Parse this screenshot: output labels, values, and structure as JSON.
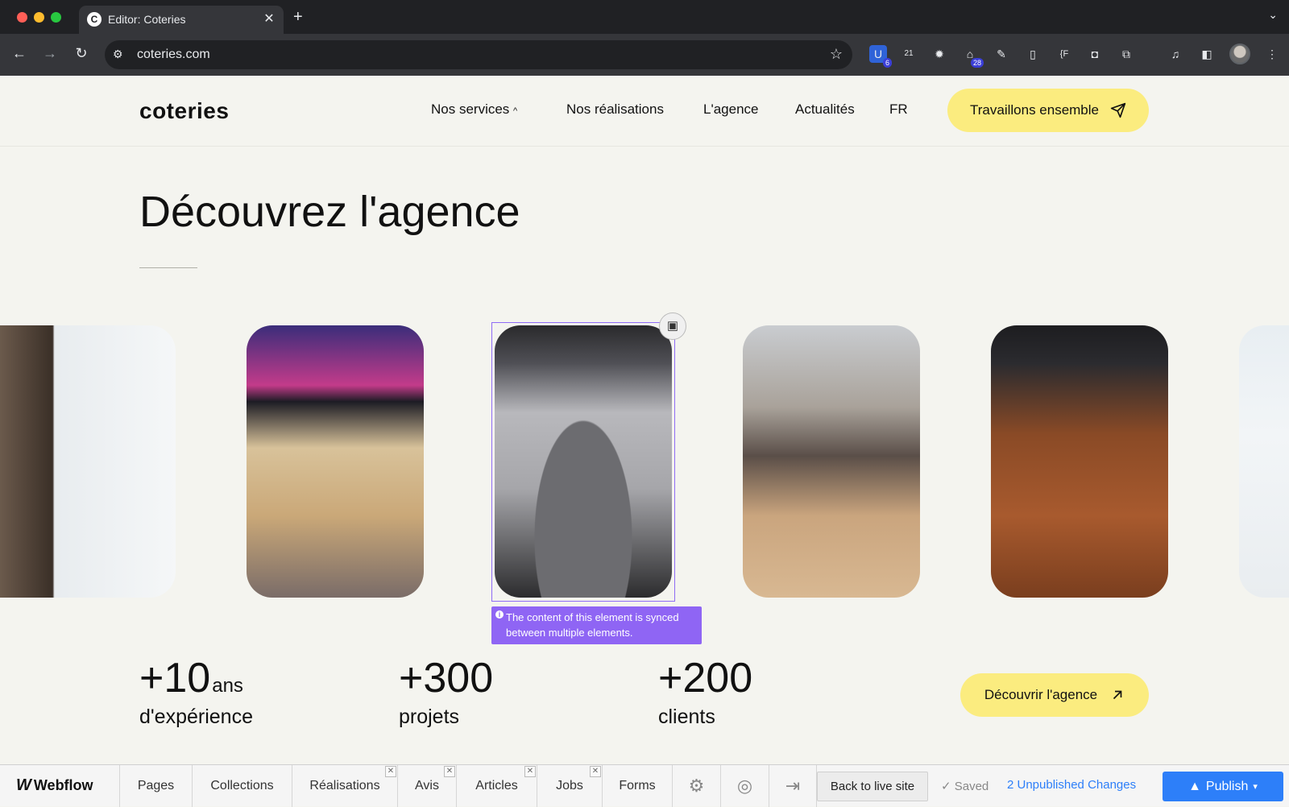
{
  "browser": {
    "tab_title": "Editor: Coteries",
    "tab_favicon_letter": "C",
    "url": "coteries.com",
    "extensions": [
      {
        "name": "shield-extension-icon",
        "badge": "6"
      },
      {
        "name": "calendar-extension-icon",
        "badge": "21"
      },
      {
        "name": "gear-extension-icon",
        "badge": ""
      },
      {
        "name": "graduation-cap-extension-icon",
        "badge": "28"
      },
      {
        "name": "eyedropper-extension-icon",
        "badge": ""
      },
      {
        "name": "bookmark-extension-icon",
        "badge": ""
      },
      {
        "name": "brackets-extension-icon",
        "badge": "{F"
      },
      {
        "name": "camera-extension-icon",
        "badge": ""
      },
      {
        "name": "puzzle-extension-icon",
        "badge": ""
      }
    ]
  },
  "site": {
    "logo": "coteries",
    "nav": [
      "Nos services",
      "Nos réalisations",
      "L'agence",
      "Actualités",
      "FR"
    ],
    "cta": "Travaillons ensemble",
    "hero_title": "Découvrez l'agence",
    "stats": [
      {
        "number": "+10",
        "unit": "ans",
        "label": "d'expérience"
      },
      {
        "number": "+300",
        "unit": "",
        "label": "projets"
      },
      {
        "number": "+200",
        "unit": "",
        "label": "clients"
      }
    ],
    "cta2": "Découvrir l'agence",
    "photos": [
      {
        "name": "photo-whiteboard"
      },
      {
        "name": "photo-computer-work"
      },
      {
        "name": "photo-coffee-machine"
      },
      {
        "name": "photo-team-meeting"
      },
      {
        "name": "photo-desk-energy-drink"
      },
      {
        "name": "photo-whiteboard-notes"
      }
    ]
  },
  "editor": {
    "sync_tooltip": "The content of this element is synced between multiple elements.",
    "brand": "Webflow",
    "tabs": [
      "Pages",
      "Collections",
      "Réalisations",
      "Avis",
      "Articles",
      "Jobs",
      "Forms"
    ],
    "back_to_live": "Back to live site",
    "saved": "✓ Saved",
    "unpublished": "2 Unpublished Changes",
    "publish": "Publish"
  },
  "colors": {
    "accent_yellow": "#fbec7f",
    "selection_purple": "#8f65f4",
    "publish_blue": "#2d7ff9"
  }
}
